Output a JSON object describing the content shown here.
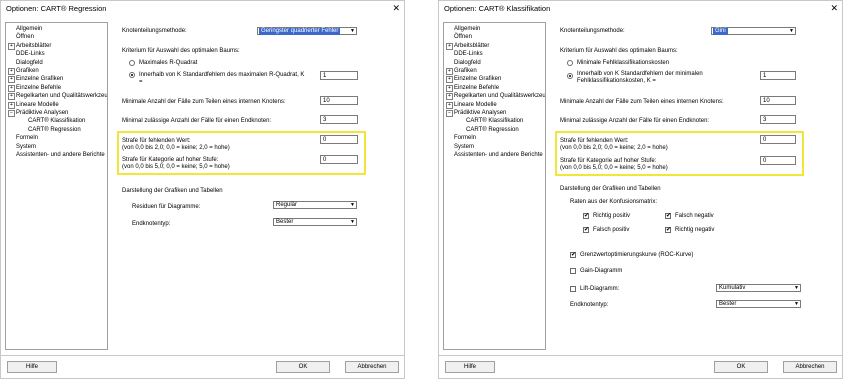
{
  "left": {
    "title": "Optionen: CART® Regression",
    "close_glyph": "✕",
    "tree": [
      {
        "label": "Allgemein",
        "exp": ""
      },
      {
        "label": "Öffnen",
        "exp": ""
      },
      {
        "label": "Arbeitsblätter",
        "exp": "+"
      },
      {
        "label": "DDE-Links",
        "exp": ""
      },
      {
        "label": "Dialogfeld",
        "exp": ""
      },
      {
        "label": "Grafiken",
        "exp": "+"
      },
      {
        "label": "Einzelne Grafiken",
        "exp": "+"
      },
      {
        "label": "Einzelne Befehle",
        "exp": "+"
      },
      {
        "label": "Regelkarten und Qualitätswerkzeug",
        "exp": "+"
      },
      {
        "label": "Lineare Modelle",
        "exp": "+"
      },
      {
        "label": "Prädiktive Analysen",
        "exp": "−"
      },
      {
        "label": "CART® Klassifikation",
        "exp": "",
        "indent": true
      },
      {
        "label": "CART® Regression",
        "exp": "",
        "indent": true
      },
      {
        "label": "Formeln",
        "exp": ""
      },
      {
        "label": "System",
        "exp": ""
      },
      {
        "label": "Assistenten- und andere Berichte",
        "exp": ""
      }
    ],
    "method_label": "Knotenteilungsmethode:",
    "method_value": "Geringster quadrierter Fehler",
    "criterion_label": "Kriterium für Auswahl des optimalen Baums:",
    "radio1": "Maximales R-Quadrat",
    "radio2a": "Innerhalb von K Standardfehlern des maximalen R-Quadrat, K",
    "radio2b": "=",
    "k_value": "1",
    "min_cases_label": "Minimale Anzahl der Fälle zum Teilen eines internen Knotens:",
    "min_cases_value": "10",
    "min_end_label": "Minimal zulässige Anzahl der Fälle für einen Endknoten:",
    "min_end_value": "3",
    "penalty_missing_a": "Strafe für fehlenden Wert:",
    "penalty_missing_b": "(von 0,0 bis 2,0; 0,0 = keine; 2,0 = hohe)",
    "penalty_missing_value": "0",
    "penalty_cat_a": "Strafe für Kategorie auf hoher Stufe:",
    "penalty_cat_b": "(von 0,0 bis 5,0; 0,0 = keine; 5,0 = hohe)",
    "penalty_cat_value": "0",
    "display_label": "Darstellung der Grafiken und Tabellen",
    "residuals_label": "Residuen für Diagramme:",
    "residuals_value": "Regulär",
    "endnode_label": "Endknotentyp:",
    "endnode_value": "Bester",
    "help": "Hilfe",
    "ok": "OK",
    "cancel": "Abbrechen"
  },
  "right": {
    "title": "Optionen: CART® Klassifikation",
    "close_glyph": "✕",
    "tree": [
      {
        "label": "Allgemein",
        "exp": ""
      },
      {
        "label": "Öffnen",
        "exp": ""
      },
      {
        "label": "Arbeitsblätter",
        "exp": "+"
      },
      {
        "label": "DDE-Links",
        "exp": ""
      },
      {
        "label": "Dialogfeld",
        "exp": ""
      },
      {
        "label": "Grafiken",
        "exp": "+"
      },
      {
        "label": "Einzelne Grafiken",
        "exp": "+"
      },
      {
        "label": "Einzelne Befehle",
        "exp": "+"
      },
      {
        "label": "Regelkarten und Qualitätswerkzeug",
        "exp": "+"
      },
      {
        "label": "Lineare Modelle",
        "exp": "+"
      },
      {
        "label": "Prädiktive Analysen",
        "exp": "−"
      },
      {
        "label": "CART® Klassifikation",
        "exp": "",
        "indent": true
      },
      {
        "label": "CART® Regression",
        "exp": "",
        "indent": true
      },
      {
        "label": "Formeln",
        "exp": ""
      },
      {
        "label": "System",
        "exp": ""
      },
      {
        "label": "Assistenten- und andere Berichte",
        "exp": ""
      }
    ],
    "method_label": "Knotenteilungsmethode:",
    "method_value": "Gini",
    "criterion_label": "Kriterium für Auswahl des optimalen Baums:",
    "radio1": "Minimale Fehlklassifikationskosten",
    "radio2a": "Innerhalb von K Standardfehlern der minimalen",
    "radio2b": "Fehlklassifikationskosten, K =",
    "k_value": "1",
    "min_cases_label": "Minimale Anzahl der Fälle zum Teilen eines internen Knotens:",
    "min_cases_value": "10",
    "min_end_label": "Minimal zulässige Anzahl der Fälle für einen Endknoten:",
    "min_end_value": "3",
    "penalty_missing_a": "Strafe für fehlenden Wert:",
    "penalty_missing_b": "(von 0,0 bis 2,0; 0,0 = keine; 2,0 = hohe)",
    "penalty_missing_value": "0",
    "penalty_cat_a": "Strafe für Kategorie auf hoher Stufe:",
    "penalty_cat_b": "(von 0,0 bis 5,0; 0,0 = keine; 5,0 = hohe)",
    "penalty_cat_value": "0",
    "display_label": "Darstellung der Grafiken und Tabellen",
    "rates_label": "Raten aus der Konfusionsmatrix:",
    "tp": "Richtig positiv",
    "fn": "Falsch negativ",
    "fp": "Falsch positiv",
    "tn": "Richtig negativ",
    "roc": "Grenzwertoptimierungskurve (ROC-Kurve)",
    "gain": "Gain-Diagramm",
    "lift": "Lift-Diagramm:",
    "lift_value": "Kumulativ",
    "endnode_label": "Endknotentyp:",
    "endnode_value": "Bester",
    "check_glyph": "✔",
    "help": "Hilfe",
    "ok": "OK",
    "cancel": "Abbrechen"
  },
  "colors": {
    "highlight": "#f2e63a",
    "selection": "#3b68c9"
  }
}
